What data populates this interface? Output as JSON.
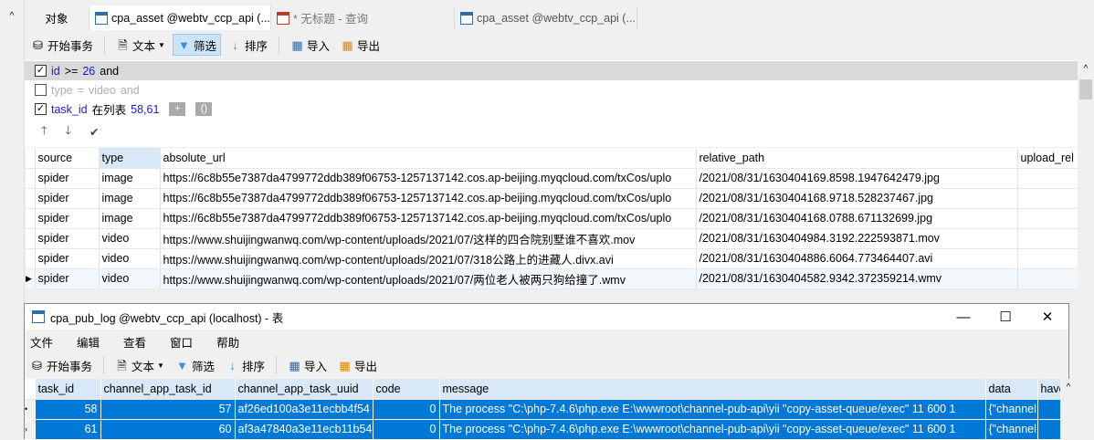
{
  "tabs": [
    {
      "label": "对象",
      "icon": "none"
    },
    {
      "label": "cpa_asset @webtv_ccp_api (...",
      "icon": "table-icon"
    },
    {
      "label": "* 无标题 - 查询",
      "icon": "query-icon"
    },
    {
      "label": "cpa_asset @webtv_ccp_api (...",
      "icon": "table-edit-icon"
    }
  ],
  "toolbar": {
    "begin": "开始事务",
    "text": "文本",
    "filter": "筛选",
    "sort": "排序",
    "import": "导入",
    "export": "导出"
  },
  "filters": [
    {
      "field": "id",
      "op": ">=",
      "value": "26",
      "join": "and",
      "checked": true
    },
    {
      "field": "type",
      "op": "=",
      "value": "video",
      "join": "and",
      "checked": false
    },
    {
      "field": "task_id",
      "op": "在列表",
      "value": "58,61",
      "checked": true
    }
  ],
  "grid": {
    "columns": [
      "source",
      "type",
      "absolute_url",
      "relative_path",
      "upload_rel"
    ],
    "rows": [
      [
        "spider",
        "image",
        "https://6c8b55e7387da4799772ddb389f06753-1257137142.cos.ap-beijing.myqcloud.com/txCos/uplo",
        "/2021/08/31/1630404169.8598.1947642479.jpg",
        ""
      ],
      [
        "spider",
        "image",
        "https://6c8b55e7387da4799772ddb389f06753-1257137142.cos.ap-beijing.myqcloud.com/txCos/uplo",
        "/2021/08/31/1630404168.9718.528237467.jpg",
        ""
      ],
      [
        "spider",
        "image",
        "https://6c8b55e7387da4799772ddb389f06753-1257137142.cos.ap-beijing.myqcloud.com/txCos/uplo",
        "/2021/08/31/1630404168.0788.671132699.jpg",
        ""
      ],
      [
        "spider",
        "video",
        "https://www.shuijingwanwq.com/wp-content/uploads/2021/07/这样的四合院别墅谁不喜欢.mov",
        "/2021/08/31/1630404984.3192.222593871.mov",
        ""
      ],
      [
        "spider",
        "video",
        "https://www.shuijingwanwq.com/wp-content/uploads/2021/07/318公路上的进藏人.divx.avi",
        "/2021/08/31/1630404886.6064.773464407.avi",
        ""
      ],
      [
        "spider",
        "video",
        "https://www.shuijingwanwq.com/wp-content/uploads/2021/07/两位老人被两只狗给撞了.wmv",
        "/2021/08/31/1630404582.9342.372359214.wmv",
        ""
      ]
    ]
  },
  "window": {
    "title": "cpa_pub_log @webtv_ccp_api (localhost) - 表",
    "menu": [
      "文件",
      "编辑",
      "查看",
      "窗口",
      "帮助"
    ],
    "columns": [
      "task_id",
      "channel_app_task_id",
      "channel_app_task_uuid",
      "code",
      "message",
      "data",
      "have"
    ],
    "rows": [
      [
        "58",
        "57",
        "af26ed100a3e11ecbb4f54",
        "0",
        "The process \"C:\\php-7.4.6\\php.exe E:\\wwwroot\\channel-pub-api\\yii \"copy-asset-queue/exec\" 11 600 1",
        "{\"channel",
        ""
      ],
      [
        "61",
        "60",
        "af3a47840a3e11ecb11b54",
        "0",
        "The process \"C:\\php-7.4.6\\php.exe E:\\wwwroot\\channel-pub-api\\yii \"copy-asset-queue/exec\" 11 600 1",
        "{\"channel",
        ""
      ]
    ]
  }
}
